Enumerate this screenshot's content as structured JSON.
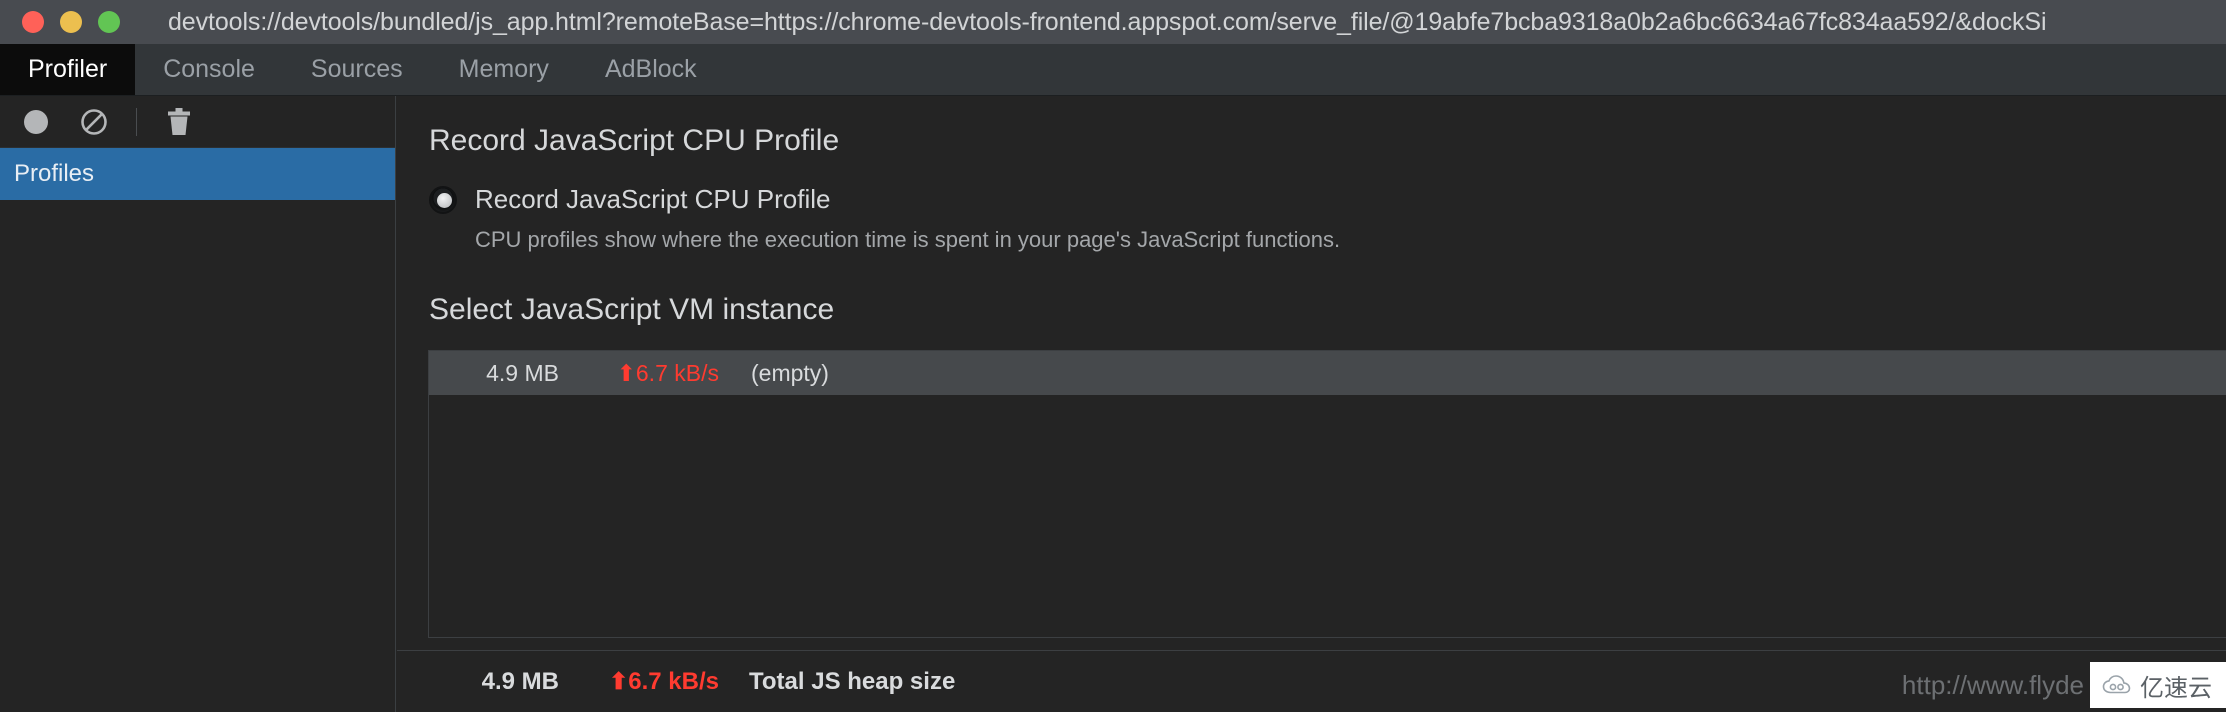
{
  "window": {
    "title": "devtools://devtools/bundled/js_app.html?remoteBase=https://chrome-devtools-frontend.appspot.com/serve_file/@19abfe7bcba9318a0b2a6bc6634a67fc834aa592/&dockSi",
    "traffic_lights": {
      "close_color": "#ff6158",
      "minimize_color": "#ecbf4f",
      "maximize_color": "#62c554"
    }
  },
  "tabs": [
    {
      "label": "Profiler",
      "active": true
    },
    {
      "label": "Console",
      "active": false
    },
    {
      "label": "Sources",
      "active": false
    },
    {
      "label": "Memory",
      "active": false
    },
    {
      "label": "AdBlock",
      "active": false
    }
  ],
  "sidebar": {
    "toolbar": [
      {
        "name": "record-button",
        "icon": "record-circle-icon"
      },
      {
        "name": "clear-button",
        "icon": "no-entry-icon"
      },
      {
        "name": "delete-button",
        "icon": "trash-icon"
      }
    ],
    "items": [
      {
        "label": "Profiles",
        "selected": true
      }
    ],
    "selected_color": "#2a6ca5"
  },
  "main": {
    "record_section": {
      "heading": "Record JavaScript CPU Profile",
      "radio_label": "Record JavaScript CPU Profile",
      "radio_checked": true,
      "description": "CPU profiles show where the execution time is spent in your page's JavaScript functions."
    },
    "select_section": {
      "heading": "Select JavaScript VM instance",
      "rows": [
        {
          "heap_size": "4.9 MB",
          "rate_arrow": "⬆",
          "rate": "6.7 kB/s",
          "name": "(empty)",
          "selected": true
        }
      ]
    },
    "footer": {
      "heap_size": "4.9 MB",
      "rate_arrow": "⬆",
      "rate": "6.7 kB/s",
      "label": "Total JS heap size"
    }
  },
  "watermark": {
    "url": "http://www.flyde",
    "badge_text": "亿速云",
    "badge_icon": "cloud-icon"
  },
  "colors": {
    "accent": "#2a6ca5",
    "alert": "#ff3b30",
    "titlebar_bg": "#484b50",
    "tabstrip_bg": "#323639",
    "panel_bg": "#242424",
    "row_selected_bg": "#46494c"
  }
}
